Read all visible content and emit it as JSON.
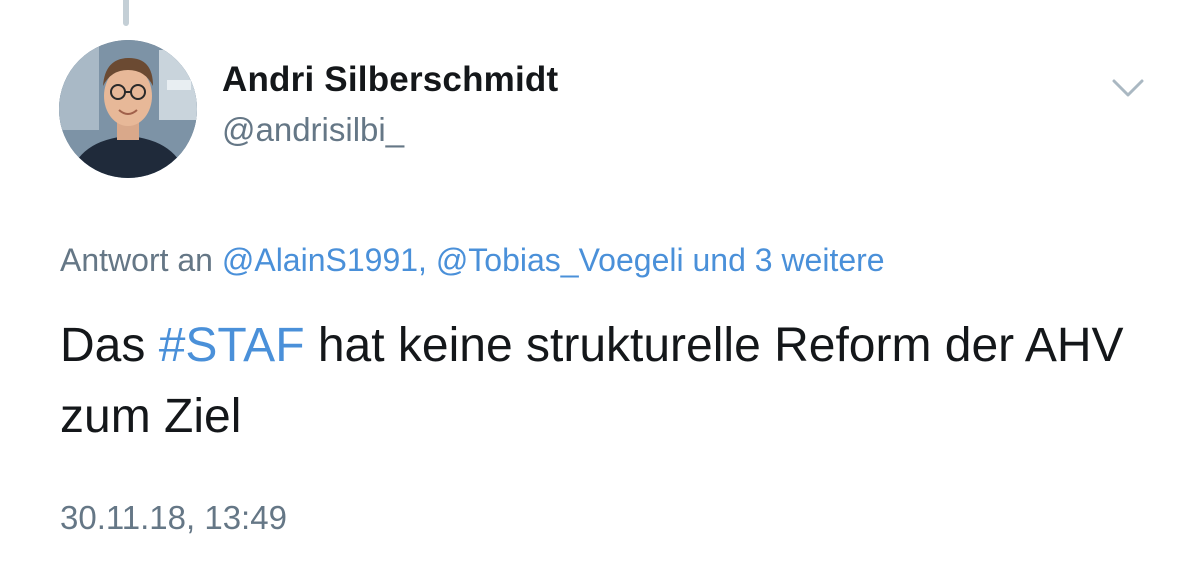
{
  "author": {
    "display_name": "Andri Silberschmidt",
    "handle": "@andrisilbi_"
  },
  "reply": {
    "prefix": "Antwort an",
    "mentions": [
      "@AlainS1991,",
      "@Tobias_Voegeli"
    ],
    "suffix_join": "und",
    "more": "3 weitere"
  },
  "tweet": {
    "text_before": "Das",
    "hashtag": "#STAF",
    "text_after": "hat keine strukturelle Reform der AHV zum Ziel"
  },
  "timestamp": "30.11.18, 13:49",
  "colors": {
    "link": "#4a90d9",
    "secondary_text": "#657786",
    "primary_text": "#14171a"
  },
  "icons": {
    "menu": "chevron-down-icon",
    "avatar": "profile-photo"
  }
}
